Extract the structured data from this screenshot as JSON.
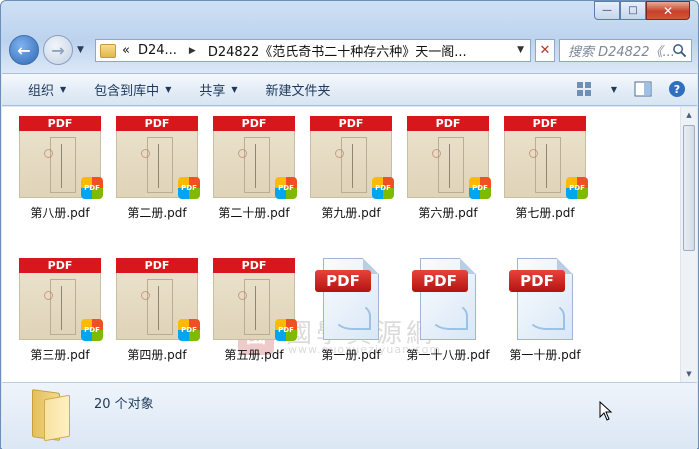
{
  "window": {
    "caption": {
      "minimize": "—",
      "maximize": "□",
      "close": "✕"
    }
  },
  "nav": {
    "back_icon": "back-arrow-icon",
    "forward_icon": "forward-arrow-icon",
    "address": {
      "overflow": "«",
      "part1": "D24...",
      "part2": "D24822《范氏奇书二十种存六种》天一阁..."
    },
    "refresh_icon": "close-x-icon",
    "search_placeholder": "搜索 D24822《..."
  },
  "toolbar": {
    "organize": "组织",
    "include_in_library": "包含到库中",
    "share": "共享",
    "new_folder": "新建文件夹"
  },
  "files": [
    {
      "name": "第八册.pdf",
      "icon": "pdf-thumbnail"
    },
    {
      "name": "第二册.pdf",
      "icon": "pdf-thumbnail"
    },
    {
      "name": "第二十册.pdf",
      "icon": "pdf-thumbnail"
    },
    {
      "name": "第九册.pdf",
      "icon": "pdf-thumbnail"
    },
    {
      "name": "第六册.pdf",
      "icon": "pdf-thumbnail"
    },
    {
      "name": "第七册.pdf",
      "icon": "pdf-thumbnail"
    },
    {
      "name": "第三册.pdf",
      "icon": "pdf-thumbnail"
    },
    {
      "name": "第四册.pdf",
      "icon": "pdf-thumbnail"
    },
    {
      "name": "第五册.pdf",
      "icon": "pdf-thumbnail"
    },
    {
      "name": "第一册.pdf",
      "icon": "pdf-document-icon"
    },
    {
      "name": "第一十八册.pdf",
      "icon": "pdf-document-icon"
    },
    {
      "name": "第一十册.pdf",
      "icon": "pdf-document-icon"
    }
  ],
  "thumb_band_text": "PDF",
  "doc_label_text": "PDF",
  "watermark": {
    "logo": "國",
    "cn": "國學資源網",
    "url": "www.guoxueziyuan.com"
  },
  "status": {
    "count": "20 个对象"
  }
}
